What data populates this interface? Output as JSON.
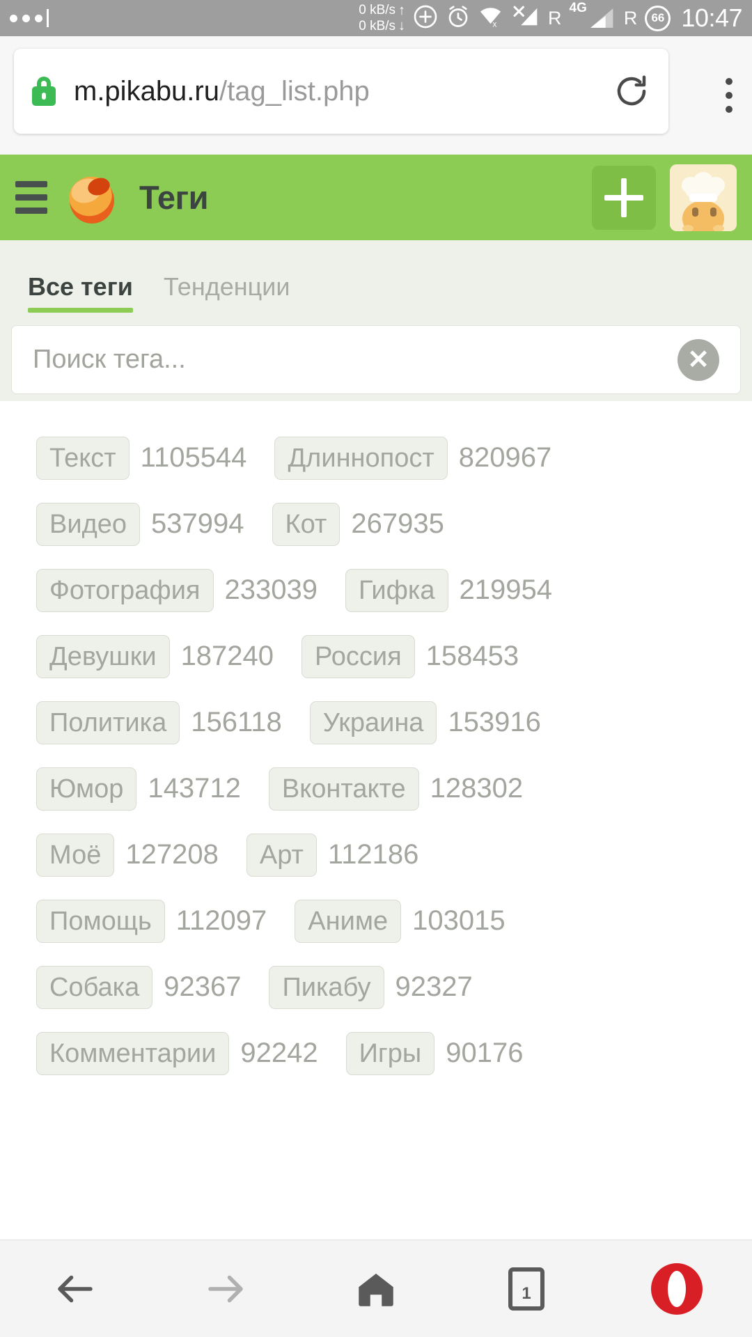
{
  "status_bar": {
    "notification_dots": "•••",
    "net_up": "0 kB/s",
    "net_down": "0 kB/s",
    "up_arrow": "↑",
    "down_arrow": "↓",
    "accessibility_icon": "accessibility-icon",
    "alarm_icon": "alarm-clock-icon",
    "wifi_off_icon": "wifi-off-icon",
    "signal_x_icon": "signal-no-service-icon",
    "roaming_1": "R",
    "network_type": "4G",
    "roaming_2": "R",
    "battery_percent": "66",
    "time": "10:47"
  },
  "browser": {
    "lock_icon": "secure-lock-icon",
    "url_host": "m.pikabu.ru",
    "url_path": "/tag_list.php",
    "reload_icon": "reload-icon",
    "menu_icon": "overflow-menu-icon"
  },
  "app_header": {
    "menu_icon": "hamburger-menu-icon",
    "logo_icon": "pikabu-logo-icon",
    "title": "Теги",
    "add_label": "+",
    "avatar_icon": "user-avatar-icon",
    "background_color": "#8ccc55"
  },
  "tabs": [
    {
      "label": "Все теги",
      "active": true
    },
    {
      "label": "Тенденции",
      "active": false
    }
  ],
  "search": {
    "value": "",
    "placeholder": "Поиск тега...",
    "clear_label": "✕",
    "clear_icon": "clear-circle-icon"
  },
  "tag_rows": [
    [
      {
        "name": "Текст",
        "count": "1105544"
      },
      {
        "name": "Длиннопост",
        "count": "820967"
      }
    ],
    [
      {
        "name": "Видео",
        "count": "537994"
      },
      {
        "name": "Кот",
        "count": "267935"
      }
    ],
    [
      {
        "name": "Фотография",
        "count": "233039"
      },
      {
        "name": "Гифка",
        "count": "219954"
      }
    ],
    [
      {
        "name": "Девушки",
        "count": "187240"
      },
      {
        "name": "Россия",
        "count": "158453"
      }
    ],
    [
      {
        "name": "Политика",
        "count": "156118"
      },
      {
        "name": "Украина",
        "count": "153916"
      }
    ],
    [
      {
        "name": "Юмор",
        "count": "143712"
      },
      {
        "name": "Вконтакте",
        "count": "128302"
      }
    ],
    [
      {
        "name": "Моё",
        "count": "127208"
      },
      {
        "name": "Арт",
        "count": "112186"
      }
    ],
    [
      {
        "name": "Помощь",
        "count": "112097"
      },
      {
        "name": "Аниме",
        "count": "103015"
      }
    ],
    [
      {
        "name": "Собака",
        "count": "92367"
      },
      {
        "name": "Пикабу",
        "count": "92327"
      }
    ],
    [
      {
        "name": "Комментарии",
        "count": "92242"
      },
      {
        "name": "Игры",
        "count": "90176"
      }
    ]
  ],
  "bottom_nav": [
    {
      "icon": "back-arrow-icon",
      "label": ""
    },
    {
      "icon": "forward-arrow-icon",
      "label": ""
    },
    {
      "icon": "home-icon",
      "label": ""
    },
    {
      "icon": "tab-switcher-icon",
      "label": "1"
    },
    {
      "icon": "opera-logo-icon",
      "label": ""
    }
  ],
  "colors": {
    "brand_green": "#8ccc55",
    "panel_gray": "#eef0ea",
    "pill_text": "#a2a69e",
    "opera_red": "#d81f26"
  }
}
